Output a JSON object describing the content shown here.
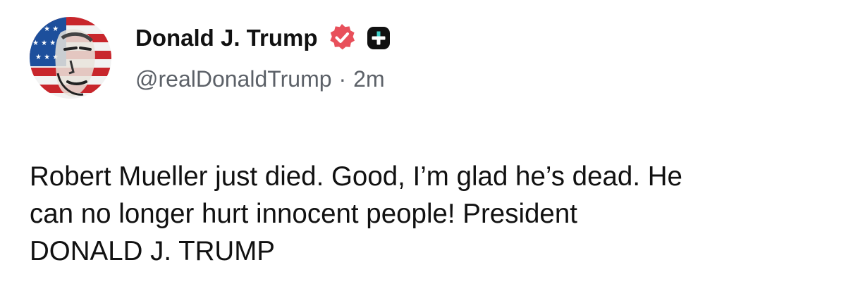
{
  "author": {
    "display_name": "Donald J. Trump",
    "handle": "@realDonaldTrump",
    "separator": "·",
    "timestamp": "2m",
    "verified_icon": "verified-badge-icon",
    "badge_icon": "plus-badge-icon"
  },
  "post": {
    "lines": [
      "Robert Mueller just died. Good, I’m glad he’s dead. He",
      "can no longer hurt innocent people! President",
      "DONALD J. TRUMP"
    ]
  },
  "colors": {
    "verified_badge": "#e8505b",
    "plus_badge": "#111111",
    "handle_text": "#5c6168",
    "body_text": "#111111"
  }
}
